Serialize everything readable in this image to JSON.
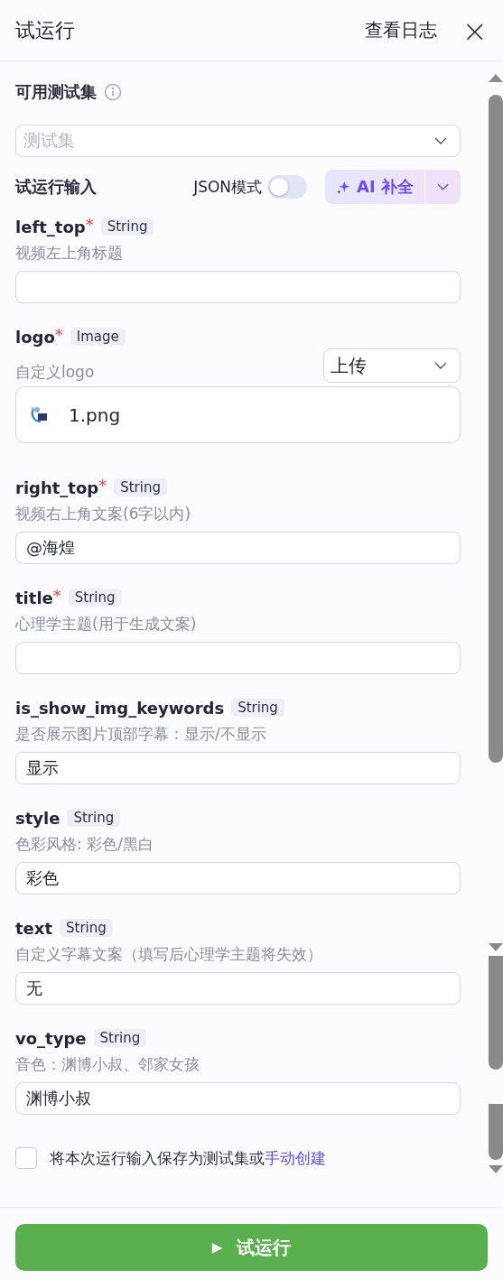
{
  "header": {
    "title": "试运行",
    "log_link": "查看日志",
    "close": "×"
  },
  "test_set": {
    "label": "可用测试集",
    "placeholder": "测试集"
  },
  "input_section": {
    "label": "试运行输入",
    "json_mode": {
      "label": "JSON模式",
      "on": false
    },
    "ai_button": "AI 补全"
  },
  "fields": [
    {
      "kind": "text",
      "name": "left_top",
      "required_mark": "*",
      "type": "String",
      "description": "视频左上角标题"
    },
    {
      "kind": "upload",
      "name": "logo",
      "required_mark": "*",
      "type": "Image",
      "description": "自定义logo",
      "source": "上传",
      "file": "1.png"
    },
    {
      "kind": "text",
      "name": "right_top",
      "required_mark": "*",
      "type": "String",
      "description": "视频右上角文案(6字以内)",
      "value": "@海煌"
    },
    {
      "kind": "text",
      "name": "title",
      "required_mark": "*",
      "type": "String",
      "description": "心理学主题(用于生成文案)"
    },
    {
      "kind": "text",
      "name": "is_show_img_keywords",
      "type": "String",
      "description": "是否展示图片顶部字幕：显示/不显示",
      "value": "显示"
    },
    {
      "kind": "text",
      "name": "style",
      "type": "String",
      "description": "色彩风格: 彩色/黑白",
      "value": "彩色"
    },
    {
      "kind": "text",
      "name": "text",
      "type": "String",
      "description": "自定义字幕文案（填写后心理学主题将失效）",
      "value": "无"
    },
    {
      "kind": "text",
      "name": "vo_type",
      "type": "String",
      "description": "音色：渊博小叔、邻家女孩",
      "value": "渊博小叔"
    }
  ],
  "save_option": {
    "checked": false,
    "text": "将本次运行输入保存为测试集或",
    "link": "手动创建"
  },
  "run_button": {
    "icon": "▶",
    "label": "试运行"
  }
}
